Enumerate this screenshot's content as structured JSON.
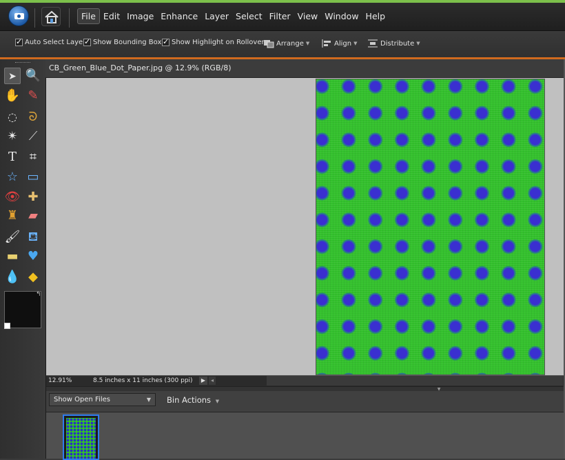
{
  "menubar": {
    "items": [
      "File",
      "Edit",
      "Image",
      "Enhance",
      "Layer",
      "Select",
      "Filter",
      "View",
      "Window",
      "Help"
    ]
  },
  "options": {
    "auto_select_layer": "Auto Select Layer",
    "show_bounding_box": "Show Bounding Box",
    "show_highlight": "Show Highlight on Rollover",
    "arrange": "Arrange",
    "align": "Align",
    "distribute": "Distribute"
  },
  "document": {
    "title": "CB_Green_Blue_Dot_Paper.jpg @ 12.9% (RGB/8)"
  },
  "status": {
    "zoom": "12.91%",
    "size": "8.5 inches x 11 inches (300 ppi)"
  },
  "bin": {
    "show_label": "Show Open Files",
    "actions_label": "Bin Actions"
  },
  "colors": {
    "accent": "#d06a1e",
    "paper_green": "#33c02c",
    "dot_blue": "#3a2fd0"
  },
  "icons": {
    "app": "camera-icon",
    "home": "home-icon"
  }
}
